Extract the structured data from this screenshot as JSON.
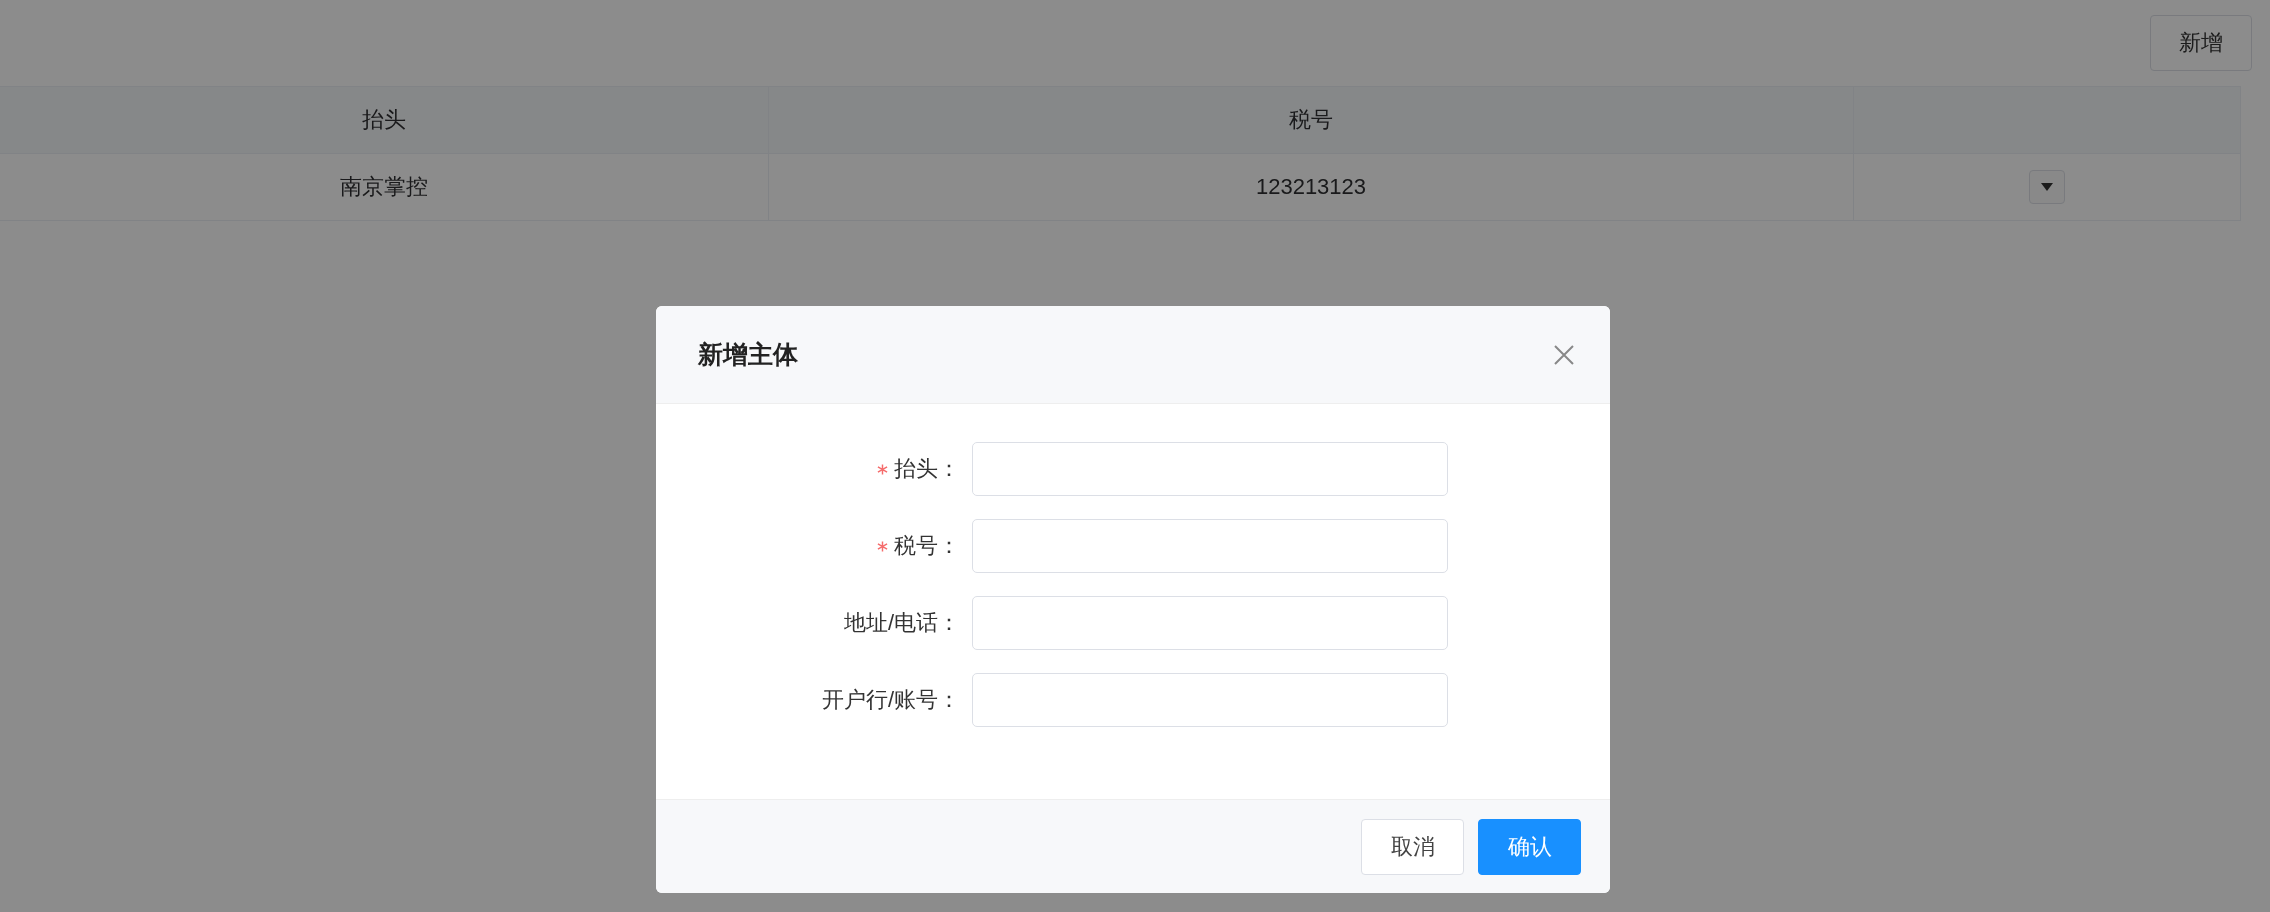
{
  "toolbar": {
    "add_button": "新增"
  },
  "table": {
    "columns": [
      "抬头",
      "税号",
      ""
    ],
    "rows": [
      {
        "cells": [
          "南京掌控",
          "123213123"
        ]
      }
    ]
  },
  "dialog": {
    "title": "新增主体",
    "fields": [
      {
        "label": "抬头：",
        "required": true
      },
      {
        "label": "税号：",
        "required": true
      },
      {
        "label": "地址/电话：",
        "required": false
      },
      {
        "label": "开户行/账号：",
        "required": false
      }
    ],
    "buttons": [
      {
        "label": "取消",
        "kind": "default"
      },
      {
        "label": "确认",
        "kind": "primary"
      }
    ]
  }
}
